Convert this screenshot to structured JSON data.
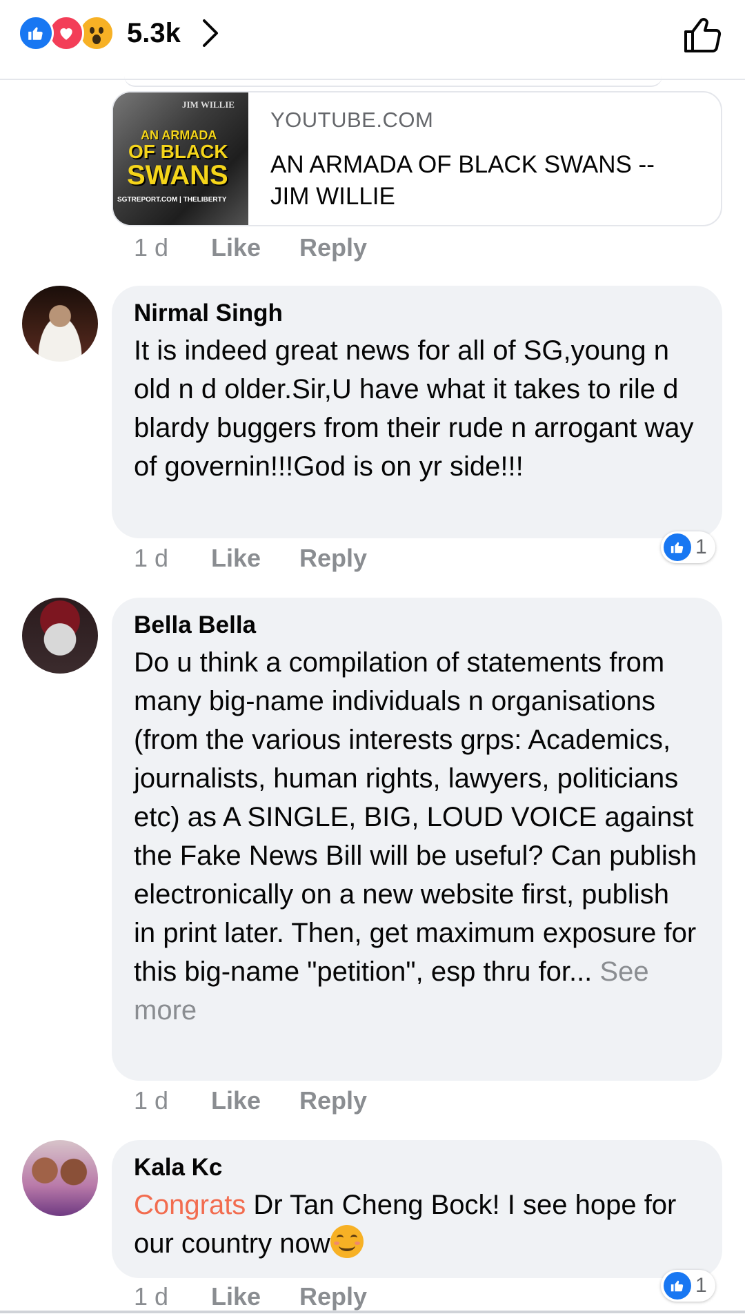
{
  "reactions": {
    "icons": [
      "like-icon",
      "love-icon",
      "wow-icon"
    ],
    "count": "5.3k"
  },
  "colors": {
    "like_blue": "#1877f2",
    "love_red": "#f33e58",
    "wow_yellow": "#f7b125",
    "bubble_bg": "#f0f2f5",
    "muted": "#8a8d91",
    "congrats": "#f26c4f"
  },
  "link_preview": {
    "thumbnail": {
      "small_name": "JIM WILLIE",
      "line1": "AN ARMADA",
      "line2": "OF BLACK",
      "line3": "SWANS",
      "site": "SGTREPORT.COM | THELIBERTY"
    },
    "domain": "YOUTUBE.COM",
    "title": "AN ARMADA OF BLACK SWANS -- JIM WILLIE",
    "actions": {
      "time": "1 d",
      "like": "Like",
      "reply": "Reply"
    }
  },
  "comments": [
    {
      "author": "Nirmal Singh",
      "text": "It is indeed great news for all of SG,young n old n d older.Sir,U have what it takes to rile d blardy buggers from their rude n arrogant way of governin!!!God is on yr side!!!",
      "time": "1 d",
      "like": "Like",
      "reply": "Reply",
      "like_count": "1"
    },
    {
      "author": "Bella Bella",
      "text": "Do u think a compilation of statements from many big-name individuals n organisations (from the various interests grps: Academics, journalists, human rights, lawyers, politicians etc) as A SINGLE, BIG, LOUD VOICE against the Fake News Bill will be useful? Can publish electronically on a new website first, publish in print later. Then, get maximum exposure for this big-name \"petition\", esp thru for...",
      "see_more": "See more",
      "time": "1 d",
      "like": "Like",
      "reply": "Reply"
    },
    {
      "author": "Kala Kc",
      "highlight": "Congrats",
      "text": " Dr Tan Cheng Bock! I see hope for our country now",
      "emoji": "smiling-face-icon",
      "time": "1 d",
      "like": "Like",
      "reply": "Reply",
      "like_count": "1"
    }
  ]
}
